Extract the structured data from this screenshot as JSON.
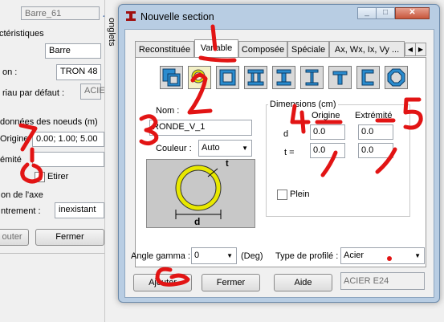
{
  "background": {
    "barre_field": "Barre_61",
    "caracteristiques_label": "ctéristiques",
    "type_field": "Barre",
    "section_label": "on :",
    "section_field": "TRON 48",
    "materiau_label": "riau par défaut :",
    "materiau_field": "ACIER",
    "coords_label": "données des noeuds (m)",
    "origine_label": "Origine",
    "origine_value": "0.00; 1.00; 5.00",
    "extremite_label": "émité",
    "etirer_label": "Etirer",
    "axe_label": "on de l'axe",
    "centrement_label": "ntrement :",
    "centrement_value": "inexistant",
    "ajouter_label": "outer",
    "fermer_label": "Fermer",
    "side_tab_label": "onglets"
  },
  "dialog": {
    "title": "Nouvelle section",
    "tabs": [
      {
        "label": "Reconstituée",
        "active": false
      },
      {
        "label": "Variable",
        "active": true
      },
      {
        "label": "Composée",
        "active": false
      },
      {
        "label": "Spéciale",
        "active": false
      },
      {
        "label": "Ax, Wx, Ix, Vy ...",
        "active": false
      }
    ],
    "shapes": [
      "box-shape-icon",
      "round-tube-icon",
      "rectangular-tube-icon",
      "i-beam-wide-icon",
      "i-beam-icon",
      "i-beam-narrow-icon",
      "t-section-icon",
      "channel-icon",
      "octagon-tube-icon"
    ],
    "nom_label": "Nom :",
    "nom_value": "RONDE_V_1",
    "couleur_label": "Couleur :",
    "couleur_value": "Auto",
    "diagram_t": "t",
    "diagram_d": "d",
    "dimensions_title": "Dimensions (cm)",
    "origine_header": "Origine",
    "extremite_header": "Extrémité",
    "row_d_label": "d",
    "row_t_label": "t  =",
    "d_origine": "0.0",
    "d_extremite": "0.0",
    "t_origine": "0.0",
    "t_extremite": "0.0",
    "plein_label": "Plein",
    "angle_label": "Angle gamma :",
    "angle_value": "0",
    "deg_label": "(Deg)",
    "profile_type_label": "Type de profilé :",
    "profile_type_value": "Acier",
    "ajouter_label": "Ajouter",
    "fermer_label": "Fermer",
    "aide_label": "Aide",
    "material_value": "ACIER E24"
  },
  "annotations": [
    "1",
    "2",
    "3",
    "4",
    "5",
    "6",
    "7"
  ],
  "colors": {
    "annotation": "#e21414",
    "tube_ring": "#e8e800",
    "diagram_bg": "#c8c8c8"
  }
}
